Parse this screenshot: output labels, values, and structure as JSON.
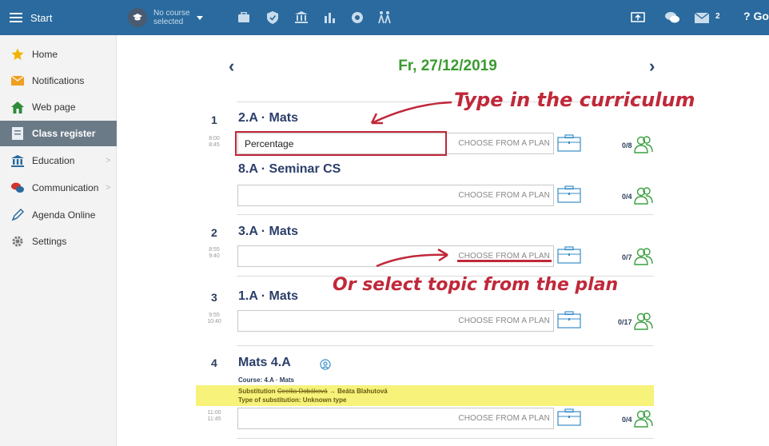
{
  "topbar": {
    "start_label": "Start",
    "course_selector": {
      "line1": "No course",
      "line2": "selected"
    },
    "mail_count": "2",
    "help_label": "? Go",
    "icons": [
      "briefcase-icon",
      "shield-icon",
      "bank-icon",
      "bar-chart-icon",
      "badge-icon",
      "people-walk-icon",
      "screen-share-icon",
      "chat-icon",
      "mail-icon"
    ]
  },
  "sidebar": {
    "items": [
      {
        "label": "Home",
        "icon": "star-icon"
      },
      {
        "label": "Notifications",
        "icon": "envelope-icon"
      },
      {
        "label": "Web page",
        "icon": "house-icon"
      },
      {
        "label": "Class register",
        "icon": "register-icon"
      },
      {
        "label": "Education",
        "icon": "bank-icon"
      },
      {
        "label": "Communication",
        "icon": "chat-icon"
      },
      {
        "label": "Agenda Online",
        "icon": "pen-icon"
      },
      {
        "label": "Settings",
        "icon": "gear-icon"
      }
    ]
  },
  "header": {
    "date": "Fr, 27/12/2019",
    "prev": "‹",
    "next": "›"
  },
  "lessons": [
    {
      "number": "1",
      "time_start": "8:00",
      "time_end": "8:45",
      "classes": [
        {
          "title": "2.A · Mats",
          "topic": "Percentage",
          "plan_label": "CHOOSE FROM A PLAN",
          "count": "0/8"
        },
        {
          "title": "8.A · Seminar CS",
          "topic": "",
          "plan_label": "CHOOSE FROM A PLAN",
          "count": "0/4"
        }
      ]
    },
    {
      "number": "2",
      "time_start": "8:55",
      "time_end": "9:40",
      "classes": [
        {
          "title": "3.A · Mats",
          "topic": "",
          "plan_label": "CHOOSE FROM A PLAN",
          "count": "0/7"
        }
      ]
    },
    {
      "number": "3",
      "time_start": "9:55",
      "time_end": "10:40",
      "classes": [
        {
          "title": "1.A · Mats",
          "topic": "",
          "plan_label": "CHOOSE FROM A PLAN",
          "count": "0/17"
        }
      ]
    },
    {
      "number": "4",
      "time_start": "11:00",
      "time_end": "11:45",
      "classes": [
        {
          "title": "Mats 4.A",
          "topic": "",
          "plan_label": "CHOOSE FROM A PLAN",
          "count": "0/4"
        }
      ],
      "course_line": "Course: 4.A · Mats",
      "substitution": {
        "label": "Substitution",
        "original_teacher": "Cecília Dobáková",
        "arrow": "→",
        "new_teacher": "Beáta Blahutová",
        "type_line": "Type of substitution:  Unknown type"
      }
    }
  ],
  "annotations": {
    "type_in": "Type in the curriculum",
    "select_plan": "Or select topic from the plan",
    "color": "#c0283a"
  },
  "colors": {
    "topbar": "#2a6a9e",
    "date_green": "#3a9a30",
    "title_navy": "#2b3e6a",
    "active_sidebar": "#6b7a87",
    "substitution_bg": "#f6f27a"
  }
}
